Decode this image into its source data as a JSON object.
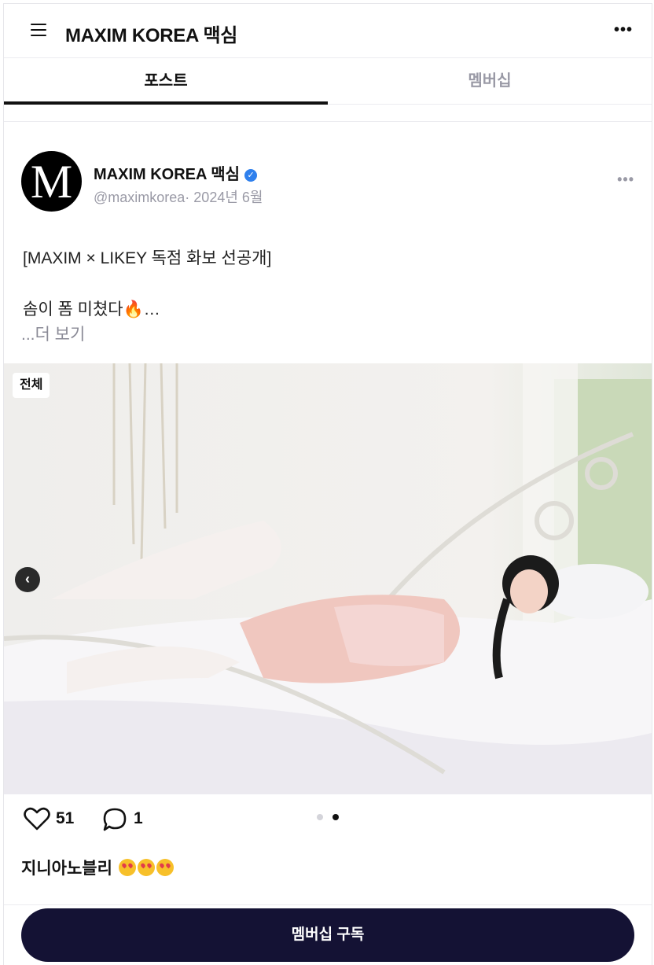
{
  "header": {
    "title": "MAXIM KOREA 맥심",
    "menu_icon": "hamburger-menu-icon",
    "more_icon": "ellipsis-icon",
    "more_label": "•••"
  },
  "tabs": [
    {
      "label": "포스트",
      "active": true
    },
    {
      "label": "멤버십",
      "active": false
    }
  ],
  "post": {
    "avatar_letter": "M",
    "author": "MAXIM KOREA 맥심",
    "verified_icon": "verified-check-icon",
    "handle": "@maximkorea",
    "date": "2024년 6월",
    "more_label": "•••",
    "text_line1": "[MAXIM × LIKEY 독점 화보 선공개]",
    "text_line2": "솜이 폼 미쳤다🔥…",
    "see_more": "...더 보기",
    "image_badge": "전체",
    "image_prev_icon": "chevron-left-icon",
    "like_count": "51",
    "comment_count": "1",
    "carousel": {
      "total": 2,
      "active_index": 2
    },
    "caption": "지니아노블리"
  },
  "cta": {
    "label": "멤버십 구독"
  },
  "colors": {
    "cta_bg": "#141234",
    "verified": "#2f80ed",
    "muted": "#9a9aa6"
  }
}
